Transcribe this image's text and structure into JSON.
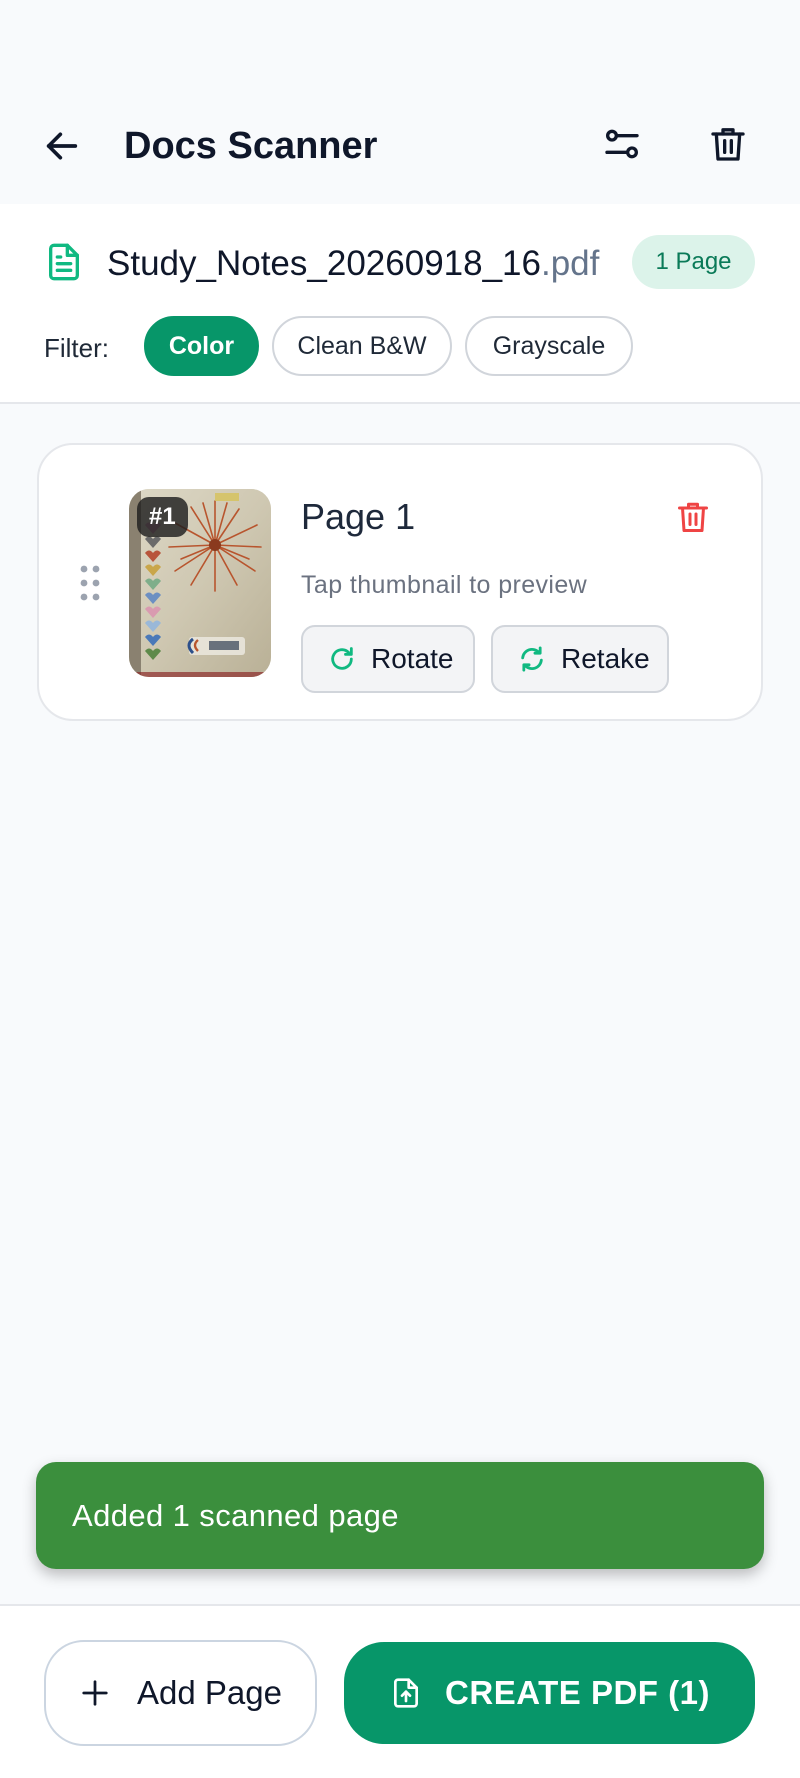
{
  "app_bar": {
    "title": "Docs Scanner",
    "back_icon": "arrow-left-icon",
    "settings_icon": "tune-icon",
    "delete_icon": "trash-icon"
  },
  "document": {
    "file_icon": "file-text-icon",
    "filename_base": "Study_Notes_20260918_16",
    "filename_ext": ".pdf",
    "page_count_badge": "1 Page"
  },
  "filter": {
    "label": "Filter:",
    "options": [
      "Color",
      "Clean B&W",
      "Grayscale"
    ],
    "selected": "Color"
  },
  "pages": [
    {
      "badge": "#1",
      "title": "Page 1",
      "hint": "Tap thumbnail to preview",
      "rotate_label": "Rotate",
      "retake_label": "Retake"
    }
  ],
  "toast": {
    "message": "Added 1 scanned page"
  },
  "bottom_bar": {
    "add_page_label": "Add Page",
    "create_pdf_label": "CREATE PDF (1)"
  },
  "colors": {
    "accent": "#079669",
    "accent_light": "#dcf3ea",
    "danger": "#ef4444",
    "toast": "#3b8f3d"
  }
}
